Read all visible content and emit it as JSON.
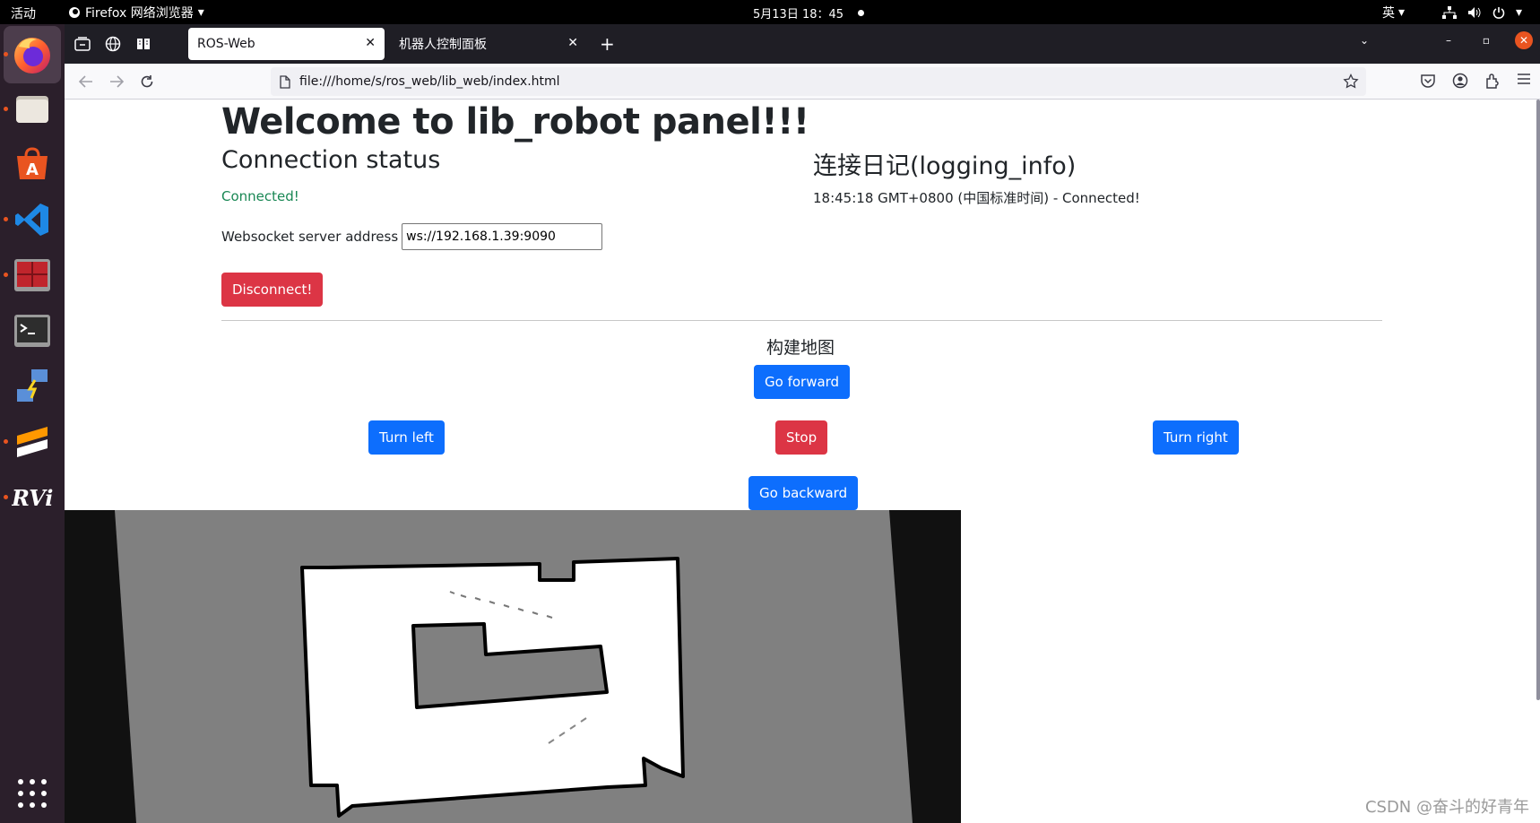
{
  "topbar": {
    "activities": "活动",
    "app_name": "Firefox 网络浏览器",
    "clock": "5月13日  18：45",
    "input_method": "英"
  },
  "browser": {
    "tabs": [
      {
        "label": "ROS-Web",
        "active": true
      },
      {
        "label": "机器人控制面板",
        "active": false
      }
    ],
    "url": "file:///home/s/ros_web/lib_web/index.html"
  },
  "page": {
    "title": "Welcome to lib_robot panel!!!",
    "connection_heading": "Connection status",
    "connection_status": "Connected!",
    "ws_label": "Websocket server address",
    "ws_value": "ws://192.168.1.39:9090",
    "disconnect_label": "Disconnect!",
    "log_heading": "连接日记(logging_info)",
    "log_entry": "18:45:18 GMT+0800 (中国标准时间) - Connected!",
    "map_heading": "构建地图",
    "controls": {
      "forward": "Go forward",
      "left": "Turn left",
      "stop": "Stop",
      "right": "Turn right",
      "backward": "Go backward"
    }
  },
  "colors": {
    "success": "#198754",
    "danger": "#dc3545",
    "primary": "#0d6efd",
    "ubuntu_orange": "#e95420"
  },
  "dock_apps": [
    "firefox-icon",
    "files-icon",
    "app-store-icon",
    "vscode-icon",
    "system-monitor-icon",
    "terminal-icon",
    "network-tool-icon",
    "sublime-icon",
    "rviz-icon"
  ],
  "watermark": "CSDN @奋斗的好青年"
}
